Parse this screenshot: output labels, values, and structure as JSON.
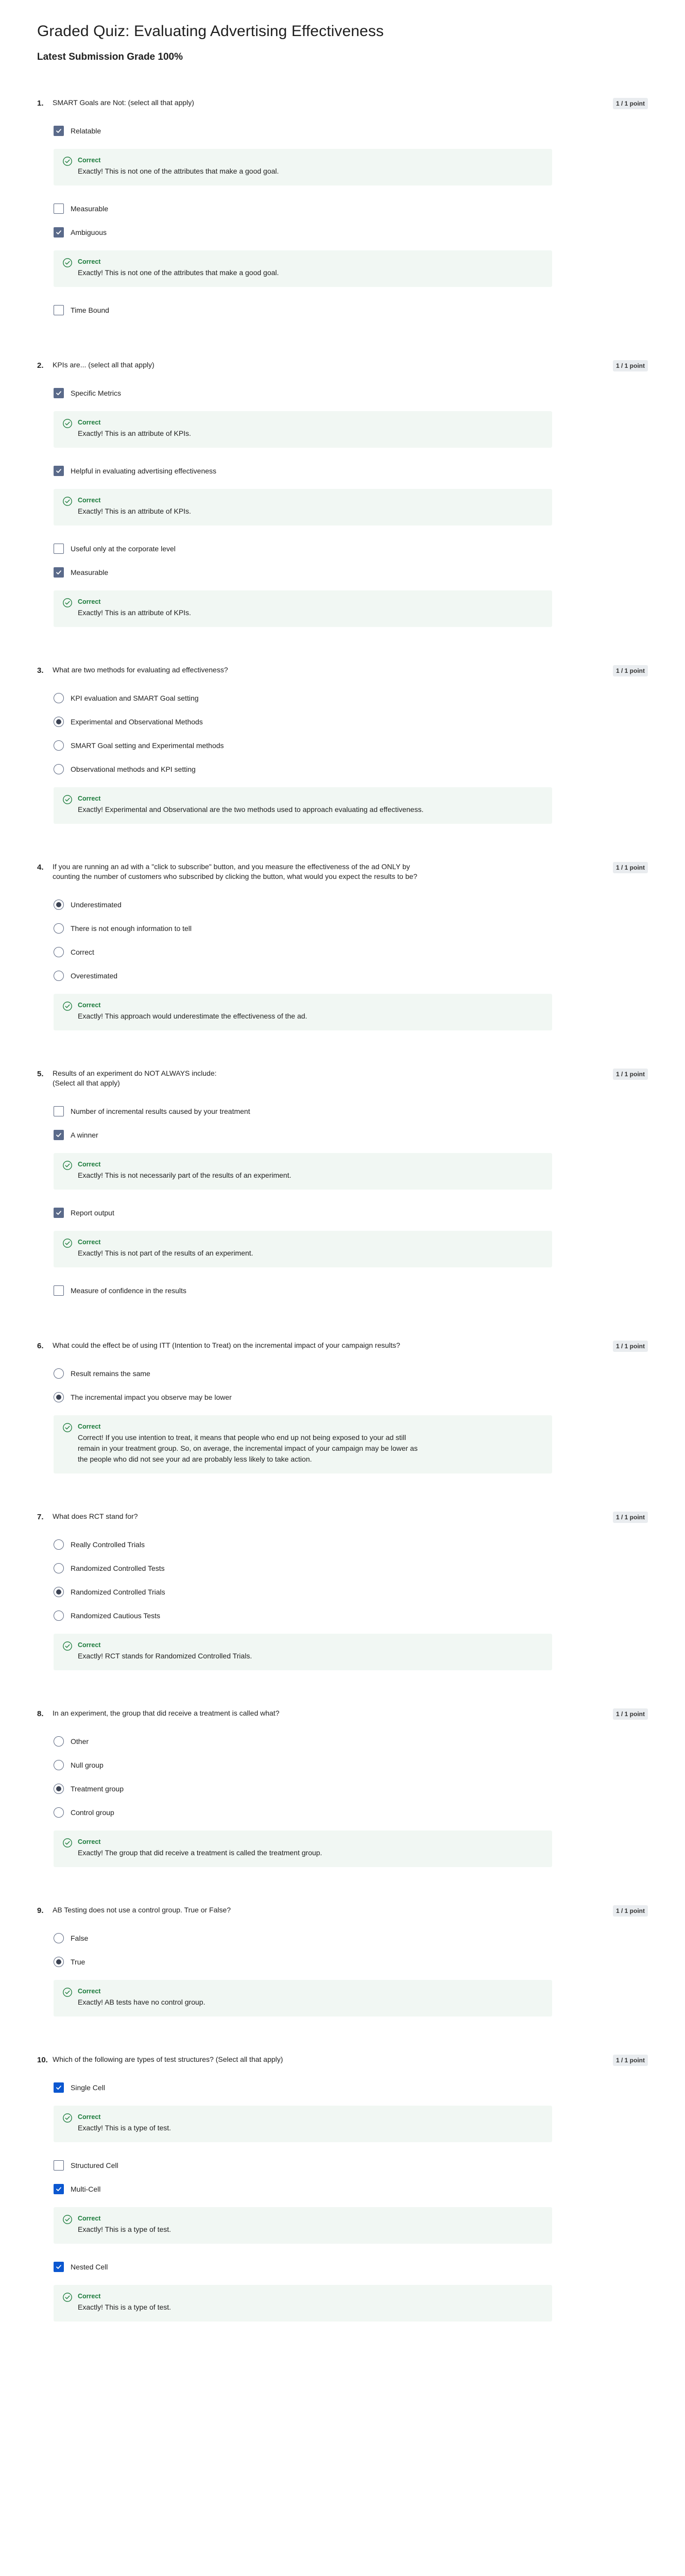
{
  "page": {
    "title": "Graded Quiz: Evaluating Advertising Effectiveness",
    "grade": "Latest Submission Grade 100%"
  },
  "questions": [
    {
      "number": "1.",
      "text": "SMART Goals are Not: (select all that apply)",
      "points": "1 / 1 point",
      "type": "checkbox",
      "options": [
        {
          "label": "Relatable",
          "selected": true,
          "feedback": {
            "title": "Correct",
            "text": "Exactly! This is not one of the attributes that make a good goal."
          }
        },
        {
          "label": "Measurable",
          "selected": false
        },
        {
          "label": "Ambiguous",
          "selected": true,
          "feedback": {
            "title": "Correct",
            "text": "Exactly! This is not one of the attributes that make a good goal."
          }
        },
        {
          "label": "Time Bound",
          "selected": false
        }
      ]
    },
    {
      "number": "2.",
      "text": "KPIs are... (select all that apply)",
      "points": "1 / 1 point",
      "type": "checkbox",
      "options": [
        {
          "label": "Specific Metrics",
          "selected": true,
          "feedback": {
            "title": "Correct",
            "text": "Exactly! This is an attribute of KPIs."
          }
        },
        {
          "label": "Helpful in evaluating advertising effectiveness",
          "selected": true,
          "feedback": {
            "title": "Correct",
            "text": "Exactly! This is an attribute of KPIs."
          }
        },
        {
          "label": "Useful only at the corporate level",
          "selected": false
        },
        {
          "label": "Measurable",
          "selected": true,
          "feedback": {
            "title": "Correct",
            "text": "Exactly! This is an attribute of KPIs."
          }
        }
      ]
    },
    {
      "number": "3.",
      "text": "What are two methods for evaluating ad effectiveness?",
      "points": "1 / 1 point",
      "type": "radio",
      "options": [
        {
          "label": "KPI evaluation and SMART Goal setting",
          "selected": false
        },
        {
          "label": "Experimental and Observational Methods",
          "selected": true
        },
        {
          "label": "SMART Goal setting and Experimental methods",
          "selected": false
        },
        {
          "label": "Observational methods and KPI setting",
          "selected": false
        }
      ],
      "feedback": {
        "title": "Correct",
        "text": "Exactly! Experimental and Observational are the two methods used to approach evaluating ad effectiveness."
      }
    },
    {
      "number": "4.",
      "text": "If you are running an ad with a \"click to subscribe\" button, and you measure the effectiveness of the ad ONLY by\ncounting the number of customers who subscribed by clicking the button, what would you expect the results to be?",
      "points": "1 / 1 point",
      "type": "radio",
      "options": [
        {
          "label": "Underestimated",
          "selected": true
        },
        {
          "label": "There is not enough information to tell",
          "selected": false
        },
        {
          "label": "Correct",
          "selected": false
        },
        {
          "label": "Overestimated",
          "selected": false
        }
      ],
      "feedback": {
        "title": "Correct",
        "text": "Exactly! This approach would underestimate the effectiveness of the ad."
      }
    },
    {
      "number": "5.",
      "text": "Results of an experiment do NOT ALWAYS include:\n(Select all that apply)",
      "points": "1 / 1 point",
      "type": "checkbox",
      "options": [
        {
          "label": "Number of incremental results caused by your treatment",
          "selected": false
        },
        {
          "label": "A winner",
          "selected": true,
          "feedback": {
            "title": "Correct",
            "text": "Exactly! This is not necessarily part of the results of an experiment."
          }
        },
        {
          "label": "Report output",
          "selected": true,
          "feedback": {
            "title": "Correct",
            "text": "Exactly! This is not part of the results of an experiment."
          }
        },
        {
          "label": "Measure of confidence in the results",
          "selected": false
        }
      ]
    },
    {
      "number": "6.",
      "text": "What could the effect be of using ITT (Intention to Treat) on the incremental impact of your campaign results?",
      "points": "1 / 1 point",
      "type": "radio",
      "options": [
        {
          "label": "Result remains the same",
          "selected": false
        },
        {
          "label": "The incremental impact you observe may be lower",
          "selected": true
        }
      ],
      "feedback": {
        "title": "Correct",
        "text": "Correct! If you use intention to treat, it means that people who end up not being exposed to your ad still\nremain in your treatment group. So, on average, the incremental impact of your campaign may be lower as\nthe people who did not see your ad are probably less likely to take action."
      }
    },
    {
      "number": "7.",
      "text": "What does RCT stand for?",
      "points": "1 / 1 point",
      "type": "radio",
      "options": [
        {
          "label": "Really Controlled Trials",
          "selected": false
        },
        {
          "label": "Randomized Controlled Tests",
          "selected": false
        },
        {
          "label": "Randomized Controlled Trials",
          "selected": true
        },
        {
          "label": "Randomized Cautious Tests",
          "selected": false
        }
      ],
      "feedback": {
        "title": "Correct",
        "text": "Exactly! RCT stands for Randomized Controlled Trials."
      }
    },
    {
      "number": "8.",
      "text": "In an experiment, the group that did receive a treatment is called what?",
      "points": "1 / 1 point",
      "type": "radio",
      "options": [
        {
          "label": "Other",
          "selected": false
        },
        {
          "label": "Null group",
          "selected": false
        },
        {
          "label": "Treatment group",
          "selected": true
        },
        {
          "label": "Control group",
          "selected": false
        }
      ],
      "feedback": {
        "title": "Correct",
        "text": "Exactly! The group that did receive a treatment is called the treatment group."
      }
    },
    {
      "number": "9.",
      "text": "AB Testing does not use a control group. True or False?",
      "points": "1 / 1 point",
      "type": "radio",
      "options": [
        {
          "label": "False",
          "selected": false
        },
        {
          "label": "True",
          "selected": true
        }
      ],
      "feedback": {
        "title": "Correct",
        "text": "Exactly! AB tests have no control group."
      }
    },
    {
      "number": "10.",
      "text": "Which of the following are types of test structures? (Select all that apply)",
      "points": "1 / 1 point",
      "type": "checkbox",
      "accent": "blue",
      "options": [
        {
          "label": "Single Cell",
          "selected": true,
          "feedback": {
            "title": "Correct",
            "text": "Exactly! This is a type of test."
          }
        },
        {
          "label": "Structured Cell",
          "selected": false
        },
        {
          "label": "Multi-Cell",
          "selected": true,
          "feedback": {
            "title": "Correct",
            "text": "Exactly! This is a type of test."
          }
        },
        {
          "label": "Nested Cell",
          "selected": true,
          "feedback": {
            "title": "Correct",
            "text": "Exactly! This is a type of test."
          }
        }
      ]
    }
  ],
  "colors": {
    "correct_green": "#1a7a3a",
    "feedback_bg": "#f1f7f3",
    "checkbox_checked": "#5a6a8a",
    "checkbox_checked_focus": "#0b57d0",
    "points_badge_bg": "#e9ecef"
  },
  "icons": {
    "checkbox_checked": "check-mark-icon",
    "feedback": "check-circle-icon"
  }
}
